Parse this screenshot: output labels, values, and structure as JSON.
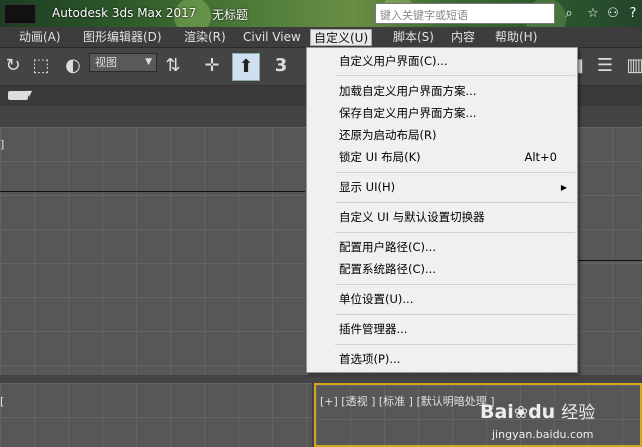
{
  "title_bar": {
    "app_name": "Autodesk 3ds Max 2017",
    "document_name": "无标题",
    "search_placeholder": "键入关键字或短语",
    "icons": [
      "binoculars-icon",
      "star-icon",
      "user-icon",
      "help-icon"
    ]
  },
  "menubar": {
    "items": [
      {
        "label": "动画(A)"
      },
      {
        "label": "图形编辑器(D)"
      },
      {
        "label": "渲染(R)"
      },
      {
        "label": "Civil View"
      },
      {
        "label": "自定义(U)",
        "active": true
      },
      {
        "label": "脚本(S)"
      },
      {
        "label": "内容"
      },
      {
        "label": "帮助(H)"
      }
    ]
  },
  "toolbar": {
    "view_select": "视图",
    "number_label": "3"
  },
  "dropdown": {
    "items": [
      {
        "label": "自定义用户界面(C)..."
      },
      {
        "label": "加载自定义用户界面方案..."
      },
      {
        "label": "保存自定义用户界面方案..."
      },
      {
        "label": "还原为启动布局(R)"
      },
      {
        "label": "锁定 UI 布局(K)",
        "shortcut": "Alt+0"
      },
      {
        "label": "显示 UI(H)",
        "submenu": true
      },
      {
        "label": "自定义 UI 与默认设置切换器"
      },
      {
        "label": "配置用户路径(C)..."
      },
      {
        "label": "配置系统路径(C)..."
      },
      {
        "label": "单位设置(U)..."
      },
      {
        "label": "插件管理器..."
      },
      {
        "label": "首选项(P)..."
      }
    ]
  },
  "viewports": {
    "top_left_label": "]",
    "bottom_left_label": "[",
    "bottom_right_label": "[+] [透视 ] [标准 ] [默认明暗处理 ]",
    "active_border_color": "#d3a520"
  },
  "watermark": {
    "brand": "Bai",
    "brand2": "du",
    "jingyan": "经验",
    "url": "jingyan.baidu.com"
  },
  "colors": {
    "menu_bg": "#3d3d3d",
    "dropdown_bg": "#f0f0f0",
    "viewport_bg": "#575757"
  }
}
